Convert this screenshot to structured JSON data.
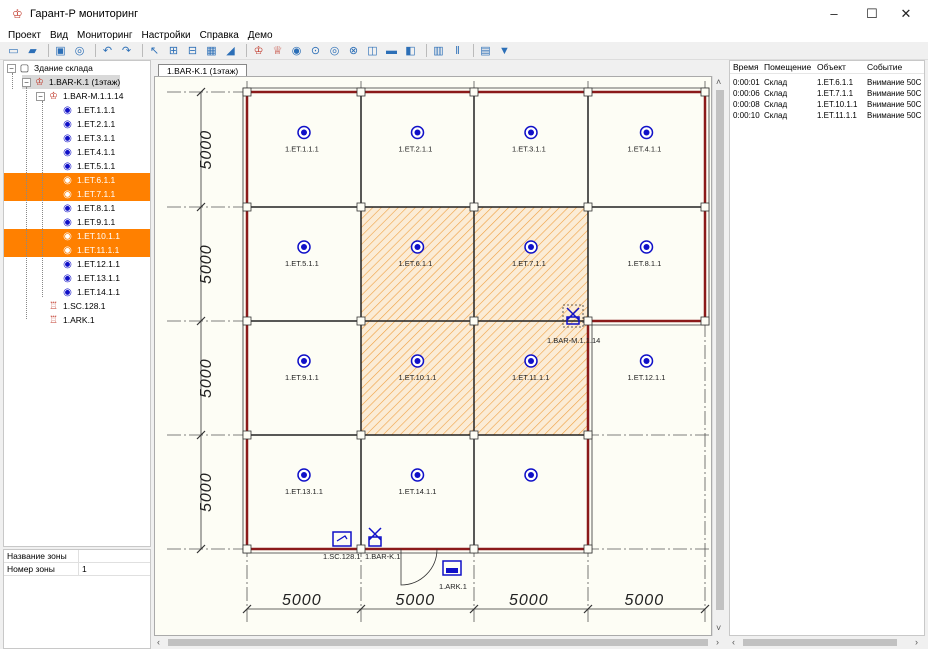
{
  "window": {
    "title": "Гарант-Р мониторинг",
    "minimize": "–",
    "maximize": "☐",
    "close": "✕"
  },
  "menu": [
    "Проект",
    "Вид",
    "Мониторинг",
    "Настройки",
    "Справка",
    "Демо"
  ],
  "toolbar_icons": [
    "new-icon",
    "open-icon",
    "save-icon",
    "database-icon",
    "undo-icon",
    "redo-icon",
    "pointer-icon",
    "grid-icon",
    "grid-alt-icon",
    "table-icon",
    "chart-icon",
    "device-icon",
    "device-alt-icon",
    "detector-icon",
    "zone-icon",
    "target-icon",
    "cross-icon",
    "window-icon",
    "block-icon",
    "panel-icon",
    "trash-icon",
    "pause-icon",
    "monitor-icon",
    "export-icon"
  ],
  "tree": {
    "root": "Здание склада",
    "floor": "1.BAR-K.1 (1этаж)",
    "module": "1.BAR-M.1.1.14",
    "sensors": [
      "1.ET.1.1.1",
      "1.ET.2.1.1",
      "1.ET.3.1.1",
      "1.ET.4.1.1",
      "1.ET.5.1.1",
      "1.ET.6.1.1",
      "1.ET.7.1.1",
      "1.ET.8.1.1",
      "1.ET.9.1.1",
      "1.ET.10.1.1",
      "1.ET.11.1.1",
      "1.ET.12.1.1",
      "1.ET.13.1.1",
      "1.ET.14.1.1"
    ],
    "highlighted": [
      "1.ET.6.1.1",
      "1.ET.7.1.1",
      "1.ET.10.1.1",
      "1.ET.11.1.1"
    ],
    "extra": [
      "1.SC.128.1",
      "1.ARK.1"
    ]
  },
  "properties": [
    {
      "key": "Название зоны",
      "value": ""
    },
    {
      "key": "Номер зоны",
      "value": "1"
    }
  ],
  "tab": "1.BAR-K.1 (1этаж)",
  "plan": {
    "dim_label": "5000",
    "module_label": "1.BAR-M.1.1.14",
    "sc_label": "1.SC.128.1",
    "bar_label": "1.BAR-K.1",
    "ark_label": "1.ARK.1",
    "alarm_color": "#f0a040",
    "wall_color": "#8b1a1a",
    "device_color": "#1010c8"
  },
  "log": {
    "headers": [
      "Время",
      "Помещение",
      "Объект",
      "Событие"
    ],
    "rows": [
      [
        "0:00:01",
        "Склад",
        "1.ET.6.1.1",
        "Внимание 50С"
      ],
      [
        "0:00:06",
        "Склад",
        "1.ET.7.1.1",
        "Внимание 50С"
      ],
      [
        "0:00:08",
        "Склад",
        "1.ET.10.1.1",
        "Внимание 50С"
      ],
      [
        "0:00:10",
        "Склад",
        "1.ET.11.1.1",
        "Внимание 50С"
      ]
    ]
  }
}
